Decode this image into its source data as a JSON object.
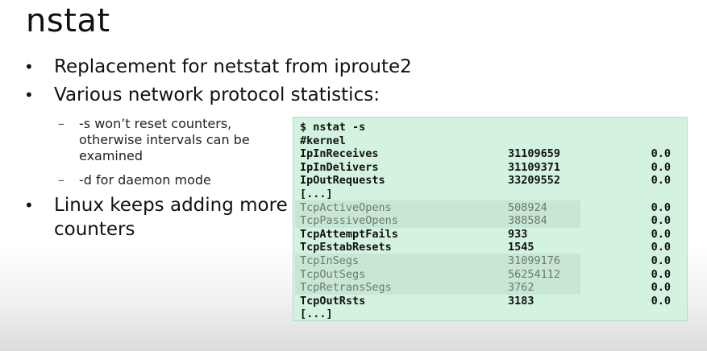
{
  "slide": {
    "title": "nstat",
    "bullets": [
      "Replacement for netstat from iproute2",
      "Various network protocol statistics:",
      "Linux keeps adding more counters"
    ],
    "sub_bullets": [
      "-s won’t reset counters, otherwise intervals can be examined",
      "-d for daemon mode"
    ],
    "bullet_symbol": "•",
    "sub_bullet_symbol": "–"
  },
  "terminal": {
    "command": "$ nstat -s",
    "header": "#kernel",
    "rows": [
      {
        "name": "IpInReceives",
        "value": "31109659",
        "rate": "0.0",
        "dim": false
      },
      {
        "name": "IpInDelivers",
        "value": "31109371",
        "rate": "0.0",
        "dim": false
      },
      {
        "name": "IpOutRequests",
        "value": "33209552",
        "rate": "0.0",
        "dim": false
      },
      {
        "name": "[...]",
        "value": "",
        "rate": "",
        "dim": false
      },
      {
        "name": "TcpActiveOpens",
        "value": "508924",
        "rate": "0.0",
        "dim": true
      },
      {
        "name": "TcpPassiveOpens",
        "value": "388584",
        "rate": "0.0",
        "dim": true
      },
      {
        "name": "TcpAttemptFails",
        "value": "933",
        "rate": "0.0",
        "dim": false
      },
      {
        "name": "TcpEstabResets",
        "value": "1545",
        "rate": "0.0",
        "dim": false
      },
      {
        "name": "TcpInSegs",
        "value": "31099176",
        "rate": "0.0",
        "dim": true
      },
      {
        "name": "TcpOutSegs",
        "value": "56254112",
        "rate": "0.0",
        "dim": true
      },
      {
        "name": "TcpRetransSegs",
        "value": "3762",
        "rate": "0.0",
        "dim": true
      },
      {
        "name": "TcpOutRsts",
        "value": "3183",
        "rate": "0.0",
        "dim": false
      },
      {
        "name": "[...]",
        "value": "",
        "rate": "",
        "dim": false
      }
    ],
    "colors": {
      "background": "#d3f2df",
      "highlight_band": "#c7e6d3",
      "dim_text": "#6c7a70"
    }
  }
}
